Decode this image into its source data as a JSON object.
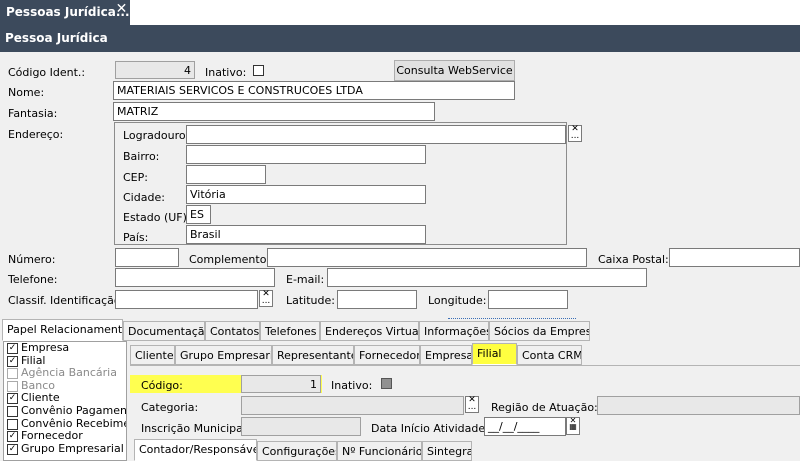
{
  "window": {
    "tab_title": "Pessoas Jurídica...",
    "tab_close": "✕",
    "header_title": "Pessoa Jurídica"
  },
  "form": {
    "codigo_label": "Código Ident.:",
    "codigo_value": "4",
    "inativo_label": "Inativo:",
    "consulta_button": "Consulta WebService",
    "nome_label": "Nome:",
    "nome_value": "MATERIAIS SERVICOS E CONSTRUCOES LTDA",
    "fantasia_label": "Fantasia:",
    "fantasia_value": "MATRIZ",
    "endereco_label": "Endereço:",
    "logradouro_label": "Logradouro:",
    "logradouro_value": "",
    "bairro_label": "Bairro:",
    "bairro_value": "",
    "cep_label": "CEP:",
    "cep_value": "",
    "cidade_label": "Cidade:",
    "cidade_value": "Vitória",
    "estado_label": "Estado (UF):",
    "estado_value": "ES",
    "pais_label": "País:",
    "pais_value": "Brasil",
    "numero_label": "Número:",
    "complemento_label": "Complemento:",
    "caixa_postal_label": "Caixa Postal:",
    "telefone_label": "Telefone:",
    "email_label": "E-mail:",
    "classif_label": "Classif. Identificação:",
    "latitude_label": "Latitude:",
    "longitude_label": "Longitude:"
  },
  "main_tabs": [
    "Papel Relacionamento",
    "Documentação",
    "Contatos",
    "Telefones",
    "Endereços Virtuais",
    "Informações",
    "Sócios da Empresa"
  ],
  "papel_list": [
    {
      "label": "Empresa",
      "checked": true,
      "enabled": true
    },
    {
      "label": "Filial",
      "checked": true,
      "enabled": true
    },
    {
      "label": "Agência Bancária",
      "checked": false,
      "enabled": false
    },
    {
      "label": "Banco",
      "checked": false,
      "enabled": false
    },
    {
      "label": "Cliente",
      "checked": true,
      "enabled": true
    },
    {
      "label": "Convênio Pagamento",
      "checked": false,
      "enabled": true
    },
    {
      "label": "Convênio Recebimento",
      "checked": false,
      "enabled": true
    },
    {
      "label": "Fornecedor",
      "checked": true,
      "enabled": true
    },
    {
      "label": "Grupo Empresarial",
      "checked": true,
      "enabled": true
    }
  ],
  "sub_tabs": [
    "Cliente",
    "Grupo Empresarial",
    "Representante",
    "Fornecedor",
    "Empresa",
    "Filial",
    "Conta CRM"
  ],
  "filial": {
    "codigo_label": "Código:",
    "codigo_value": "1",
    "inativo_label": "Inativo:",
    "categoria_label": "Categoria:",
    "regiao_label": "Região de Atuação:",
    "inscricao_label": "Inscrição Municipal:",
    "data_inicio_label": "Data Início Atividade:",
    "data_inicio_value": "__/__/____"
  },
  "bottom_tabs": [
    "Contador/Responsável",
    "Configurações",
    "Nº Funcionários",
    "Sintegra"
  ],
  "icons": {
    "dots": "...",
    "clear": "✕",
    "check": "✓",
    "calendar": "▦"
  },
  "colors": {
    "header_bg": "#3c4a5c",
    "highlight": "#ffff40"
  }
}
